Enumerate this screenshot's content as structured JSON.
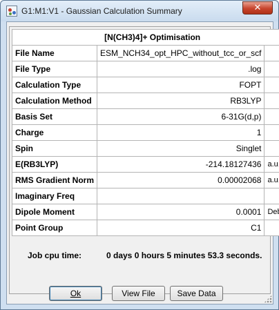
{
  "window": {
    "title": "G1:M1:V1 - Gaussian Calculation Summary",
    "close_label": "✕"
  },
  "summary": {
    "heading": "[N(CH3)4]+ Optimisation",
    "rows": [
      {
        "label": "File Name",
        "value": "ESM_NCH34_opt_HPC_without_tcc_or_scf",
        "unit": ""
      },
      {
        "label": "File Type",
        "value": ".log",
        "unit": ""
      },
      {
        "label": "Calculation Type",
        "value": "FOPT",
        "unit": ""
      },
      {
        "label": "Calculation Method",
        "value": "RB3LYP",
        "unit": ""
      },
      {
        "label": "Basis Set",
        "value": "6-31G(d,p)",
        "unit": ""
      },
      {
        "label": "Charge",
        "value": "1",
        "unit": ""
      },
      {
        "label": "Spin",
        "value": "Singlet",
        "unit": ""
      },
      {
        "label": "E(RB3LYP)",
        "value": "-214.18127436",
        "unit": "a.u."
      },
      {
        "label": "RMS Gradient Norm",
        "value": "0.00002068",
        "unit": "a.u."
      },
      {
        "label": "Imaginary Freq",
        "value": "",
        "unit": ""
      },
      {
        "label": "Dipole Moment",
        "value": "0.0001",
        "unit": "Debye"
      },
      {
        "label": "Point Group",
        "value": "C1",
        "unit": ""
      }
    ]
  },
  "cpu": {
    "label": "Job cpu time:",
    "value": "0 days  0 hours  5 minutes 53.3 seconds."
  },
  "buttons": {
    "ok_label": "Ok",
    "view_label": "View File",
    "save_label": "Save Data"
  }
}
